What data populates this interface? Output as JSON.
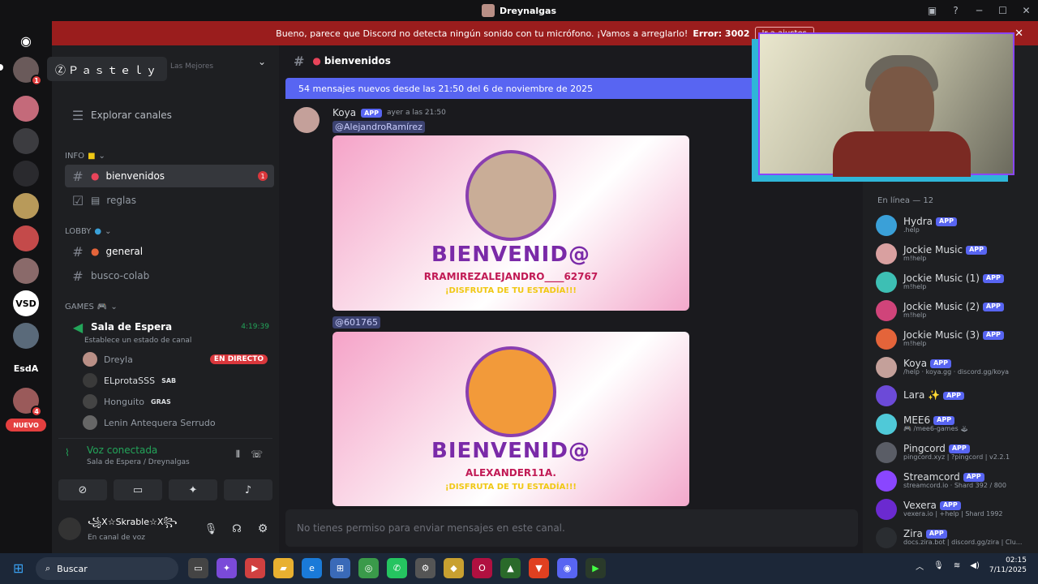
{
  "window": {
    "title": "Dreynalgas",
    "controls": [
      "gift-icon",
      "help-icon",
      "minimize",
      "maximize",
      "close"
    ]
  },
  "banner": {
    "text": "Bueno, parece que Discord no detecta ningún sonido con tu micrófono. ¡Vamos a arreglarlo!",
    "error": "Error: 3002",
    "button": "Ir a ajustes"
  },
  "server_list": {
    "tooltip": "ⓏＰａｓｔｅｌｙ",
    "badges": [
      "1",
      "4"
    ],
    "esda_label": "EsdA",
    "nuevo_label": "NUEVO"
  },
  "sidebar": {
    "top_partial": "Las Mejores",
    "explore": "Explorar canales",
    "categories": {
      "info": "INFO",
      "lobby": "LOBBY",
      "games": "GAMES"
    },
    "channels": [
      {
        "name": "bienvenidos",
        "unread": "1"
      },
      {
        "name": "reglas"
      },
      {
        "name": "general"
      },
      {
        "name": "busco-colab"
      }
    ],
    "voice_channel": {
      "name": "Sala de Espera",
      "timer": "4:19:39",
      "status_hint": "Establece un estado de canal",
      "users": [
        {
          "name": "Dreyla",
          "live": "EN DIRECTO"
        },
        {
          "name": "ELprotaSSS",
          "tag": "SAB"
        },
        {
          "name": "Honguito",
          "tag": "GRAS"
        },
        {
          "name": "Lenin Antequera Serrudo"
        }
      ]
    },
    "voice_status": {
      "title": "Voz conectada",
      "subtitle": "Sala de Espera / Dreynalgas"
    },
    "user": {
      "name": "꧁X☆Skrable☆X꧂",
      "status": "En canal de voz"
    }
  },
  "main": {
    "channel": "bienvenidos",
    "new_messages": "54 mensajes nuevos desde las 21:50 del 6 de noviembre de 2025",
    "message": {
      "author": "Koya",
      "app_tag": "APP",
      "time": "ayer a las 21:50",
      "mentions": [
        "@AlejandroRamírez",
        "@601765"
      ],
      "cards": [
        {
          "title": "BIENVENID@",
          "name": "RRAMIREZALEJANDRO____62767",
          "enjoy": "¡DISFRUTA DE TU ESTADÍA!!!"
        },
        {
          "title": "BIENVENID@",
          "name": "ALEXANDER11A.",
          "enjoy": "¡DISFRUTA DE TU ESTADÍA!!!"
        }
      ]
    },
    "input_placeholder": "No tienes permiso para enviar mensajes en este canal."
  },
  "members": {
    "header": "En línea — 12",
    "list": [
      {
        "name": "Hydra",
        "sub": ".help",
        "color": "#3aa0d8"
      },
      {
        "name": "Jockie Music",
        "sub": "m!help",
        "color": "#d9a0a0"
      },
      {
        "name": "Jockie Music (1)",
        "sub": "m!help",
        "color": "#3dbfb4"
      },
      {
        "name": "Jockie Music (2)",
        "sub": "m!help",
        "color": "#d0447a"
      },
      {
        "name": "Jockie Music (3)",
        "sub": "m!help",
        "color": "#e4643a"
      },
      {
        "name": "Koya",
        "sub": "/help · koya.gg · discord.gg/koya",
        "color": "#c4a09a"
      },
      {
        "name": "Lara ✨",
        "sub": "",
        "color": "#6c4ad8"
      },
      {
        "name": "MEE6",
        "sub": "🎮 /mee6-games 🕹",
        "color": "#4fc9d8"
      },
      {
        "name": "Pingcord",
        "sub": "pingcord.xyz | ?pingcord | v2.2.1",
        "color": "#5a5d66"
      },
      {
        "name": "Streamcord",
        "sub": "streamcord.io · Shard 392 / 800",
        "color": "#8a46ff"
      },
      {
        "name": "Vexera",
        "sub": "vexera.io | +help | Shard 1992",
        "color": "#6b2ad0"
      },
      {
        "name": "Zira",
        "sub": "docs.zira.bot | discord.gg/zira | Clu...",
        "color": "#2a2d31"
      }
    ],
    "app_tag": "APP"
  },
  "taskbar": {
    "search": "Buscar",
    "time": "02:15",
    "date": "7/11/2025"
  }
}
